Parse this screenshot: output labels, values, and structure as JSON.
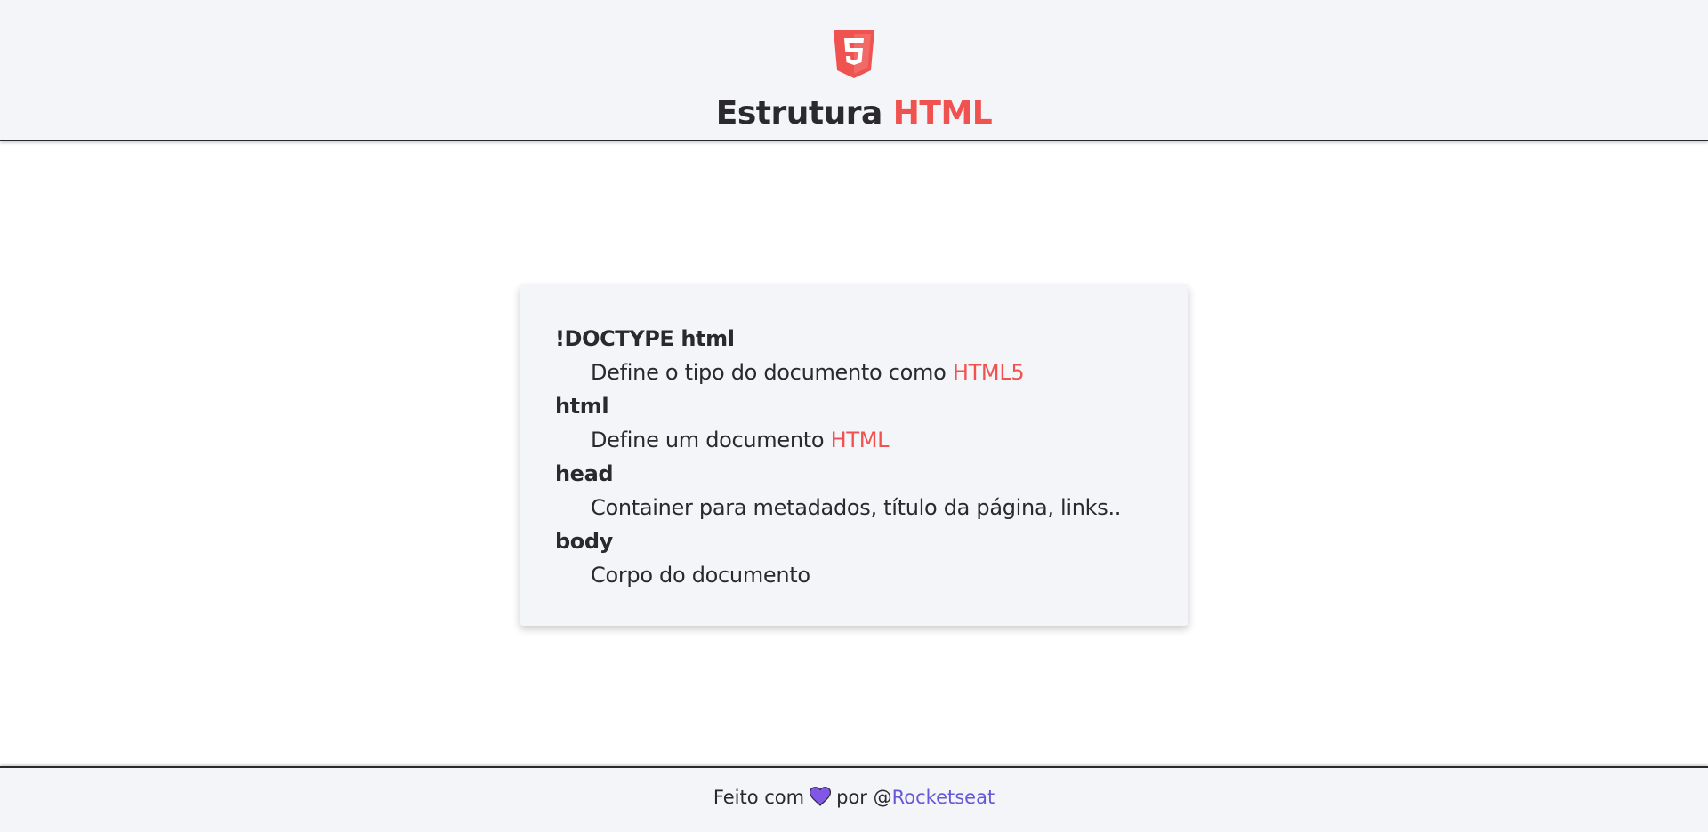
{
  "header": {
    "logo_icon": "html5-logo-icon",
    "title_main": "Estrutura",
    "title_accent": "HTML"
  },
  "definitions": [
    {
      "term": "!DOCTYPE html",
      "description": "Define o tipo do documento como ",
      "description_accent": "HTML5"
    },
    {
      "term": "html",
      "description": "Define um documento ",
      "description_accent": "HTML"
    },
    {
      "term": "head",
      "description": "Container para metadados, título da página, links..",
      "description_accent": ""
    },
    {
      "term": "body",
      "description": "Corpo do documento",
      "description_accent": ""
    }
  ],
  "footer": {
    "made_with": "Feito com",
    "heart_icon": "heart-icon",
    "by": "por @",
    "author": "Rocketseat"
  },
  "colors": {
    "accent": "#f0524f",
    "text": "#29292e",
    "surface": "#f4f5f8",
    "link": "#6558d9",
    "heart": "#8257e5"
  }
}
